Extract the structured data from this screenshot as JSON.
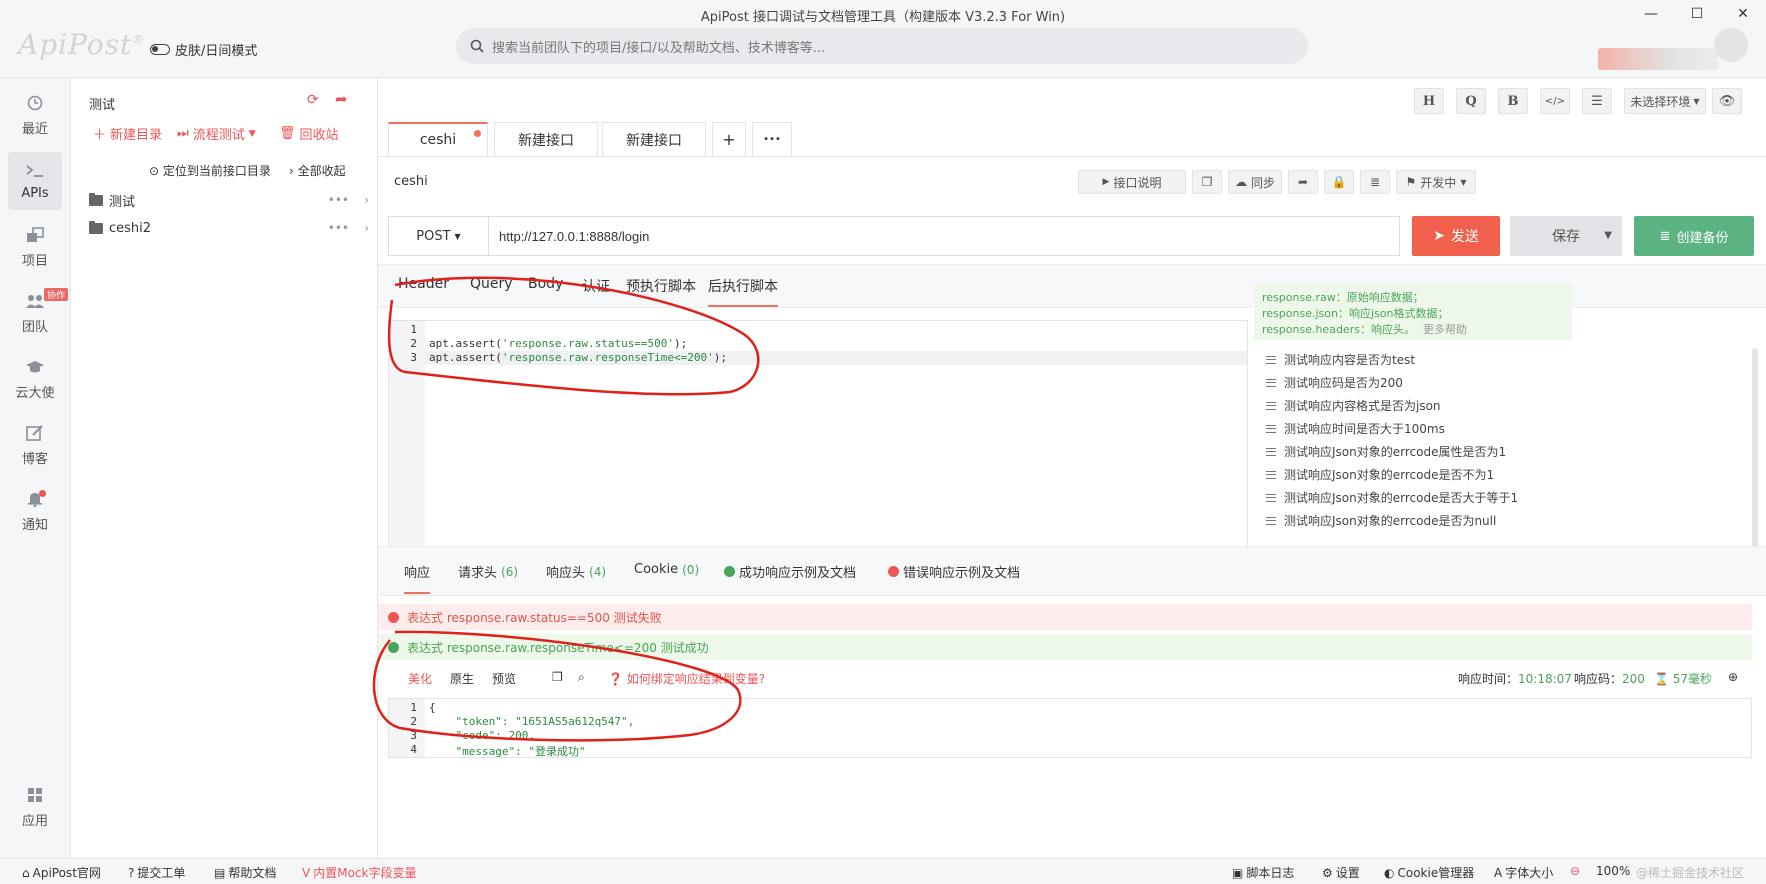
{
  "window": {
    "title": "ApiPost 接口调试与文档管理工具（构建版本 V3.2.3 For Win)",
    "logo": "ApiPost",
    "logo_mark": "®",
    "skin_toggle": "皮肤/日间模式",
    "search_placeholder": "搜索当前团队下的项目/接口/以及帮助文档、技术博客等...",
    "min": "—",
    "max": "☐",
    "close": "✕"
  },
  "nav": {
    "items": [
      {
        "label": "最近",
        "icon": "clock-icon"
      },
      {
        "label": "APIs",
        "icon": "terminal-icon"
      },
      {
        "label": "项目",
        "icon": "project-icon"
      },
      {
        "label": "团队",
        "icon": "team-icon",
        "badge": "协作"
      },
      {
        "label": "云大使",
        "icon": "graduation-cap-icon"
      },
      {
        "label": "博客",
        "icon": "edit-icon"
      },
      {
        "label": "通知",
        "icon": "bell-icon"
      },
      {
        "label": "应用",
        "icon": "apps-grid-icon"
      }
    ]
  },
  "tree": {
    "title": "测试",
    "new_dir": "新建目录",
    "flow_test": "流程测试",
    "recycle": "回收站",
    "locate": "定位到当前接口目录",
    "collapse": "全部收起",
    "folders": [
      "测试",
      "ceshi2"
    ]
  },
  "toolbar": {
    "buttons": [
      "H",
      "Q",
      "B",
      "</>",
      "☰"
    ],
    "env": "未选择环境"
  },
  "tabs": [
    {
      "label": "ceshi",
      "active": true
    },
    {
      "label": "新建接口",
      "active": false
    },
    {
      "label": "新建接口",
      "active": false
    }
  ],
  "tab_add": "+",
  "tab_more": "•••",
  "api": {
    "name": "ceshi",
    "desc_btn": "接口说明",
    "sync_btn": "同步",
    "status": "开发中"
  },
  "request": {
    "method": "POST",
    "url": "http://127.0.0.1:8888/login",
    "send": "发送",
    "save": "保存",
    "backup": "创建备份"
  },
  "param_tabs": [
    "Header",
    "Query",
    "Body",
    "认证",
    "预执行脚本",
    "后执行脚本"
  ],
  "editor": {
    "lines": [
      {
        "no": "1",
        "code": "",
        "str": "",
        "end": ""
      },
      {
        "no": "2",
        "code": "apt.assert(",
        "str": "'response.raw.status==500'",
        "end": ");"
      },
      {
        "no": "3",
        "code": "apt.assert(",
        "str": "'response.raw.responseTime<=200'",
        "end": ");"
      }
    ]
  },
  "snippets": {
    "help1_key": "response.raw",
    "help1_val": "：原始响应数据；",
    "help2_key": "response.json",
    "help2_val": "：响应json格式数据；",
    "help3_key": "response.headers",
    "help3_val": "：响应头。",
    "more": "更多帮助",
    "items": [
      "测试响应内容是否为test",
      "测试响应码是否为200",
      "测试响应内容格式是否为json",
      "测试响应时间是否大于100ms",
      "测试响应Json对象的errcode属性是否为1",
      "测试响应Json对象的errcode是否不为1",
      "测试响应Json对象的errcode是否大于等于1",
      "测试响应Json对象的errcode是否为null"
    ]
  },
  "response": {
    "tabs": {
      "resp": "响应",
      "req_headers": "请求头",
      "req_headers_count": "(6)",
      "resp_headers": "响应头",
      "resp_headers_count": "(4)",
      "cookie": "Cookie",
      "cookie_count": "(0)",
      "success_doc": "成功响应示例及文档",
      "error_doc": "错误响应示例及文档"
    },
    "assert_fail": "表达式 response.raw.status==500 测试失败",
    "assert_pass": "表达式 response.raw.responseTime<=200 测试成功",
    "view_tabs": [
      "美化",
      "原生",
      "预览"
    ],
    "bind_help": "如何绑定响应结果到变量?",
    "time_label": "响应时间：",
    "time_value": "10:18:07",
    "code_label": "响应码：",
    "code_value": "200",
    "duration": "57毫秒",
    "body_lines": [
      {
        "no": "1",
        "text": "{"
      },
      {
        "no": "2",
        "text": "    \"token\": \"1651AS5a612q547\","
      },
      {
        "no": "3",
        "text": "    \"code\": 200,"
      },
      {
        "no": "4",
        "text": "    \"message\": \"登录成功\""
      }
    ]
  },
  "statusbar": {
    "site": "ApiPost官网",
    "ticket": "提交工单",
    "help": "帮助文档",
    "mock": "内置Mock字段变量",
    "log": "脚本日志",
    "settings": "设置",
    "cookie": "Cookie管理器",
    "font": "字体大小",
    "zoom": "100%",
    "watermark": "@稀土掘金技术社区"
  },
  "colors": {
    "accent": "#f0604d",
    "success": "#5ab380",
    "annotation": "#e0201a"
  }
}
